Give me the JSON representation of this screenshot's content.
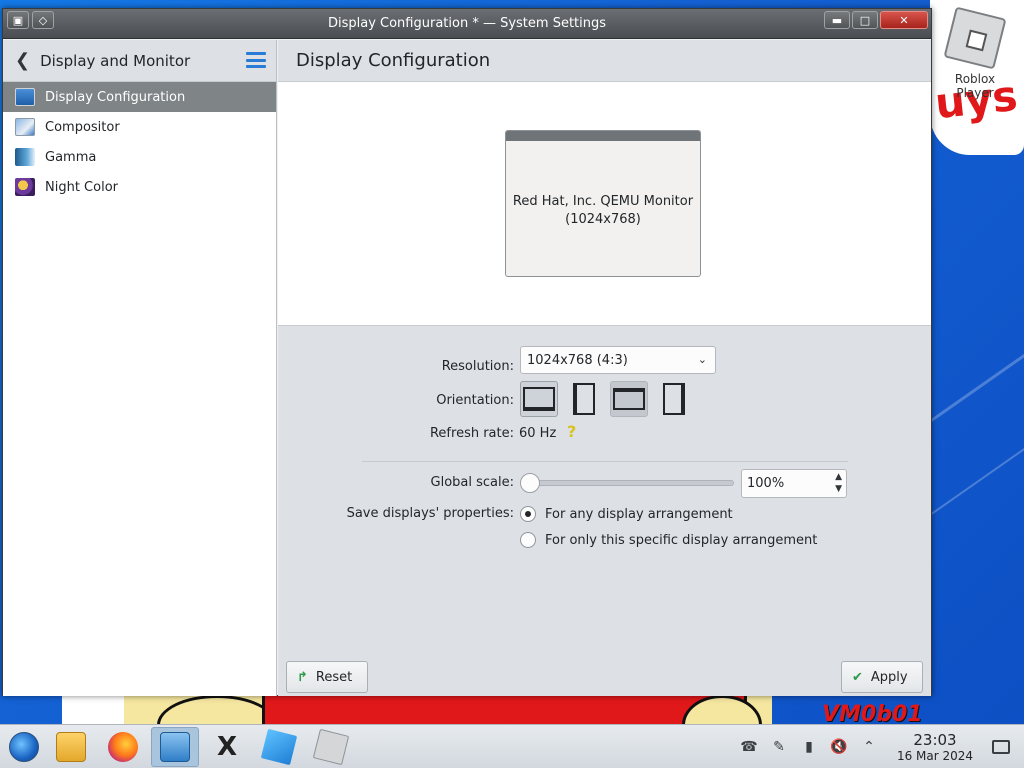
{
  "window": {
    "title": "Display Configuration * — System Settings"
  },
  "desktop": {
    "icon_label": "Roblox Player",
    "wallpaper_text": "uys",
    "wallpaper_tag": "VM0b01"
  },
  "sidebar": {
    "header": "Display and Monitor",
    "items": [
      {
        "label": "Display Configuration",
        "icon": "display-icon",
        "active": true
      },
      {
        "label": "Compositor",
        "icon": "compositor-icon",
        "active": false
      },
      {
        "label": "Gamma",
        "icon": "gamma-icon",
        "active": false
      },
      {
        "label": "Night Color",
        "icon": "night-color-icon",
        "active": false
      }
    ]
  },
  "main": {
    "title": "Display Configuration",
    "monitor": {
      "name": "Red Hat, Inc. QEMU Monitor",
      "resolution": "(1024x768)"
    },
    "resolution": {
      "label": "Resolution:",
      "value": "1024x768 (4:3)"
    },
    "orientation": {
      "label": "Orientation:"
    },
    "refresh": {
      "label": "Refresh rate:",
      "value": "60 Hz",
      "help_icon": "?"
    },
    "scale": {
      "label": "Global scale:",
      "value": "100%",
      "level": 0
    },
    "save": {
      "label": "Save displays' properties:",
      "options": [
        {
          "label": "For any display arrangement",
          "checked": true
        },
        {
          "label": "For only this specific display arrangement",
          "checked": false
        }
      ]
    },
    "buttons": {
      "reset": "Reset",
      "apply": "Apply"
    }
  },
  "taskbar": {
    "time": "23:03",
    "date": "16 Mar 2024"
  }
}
